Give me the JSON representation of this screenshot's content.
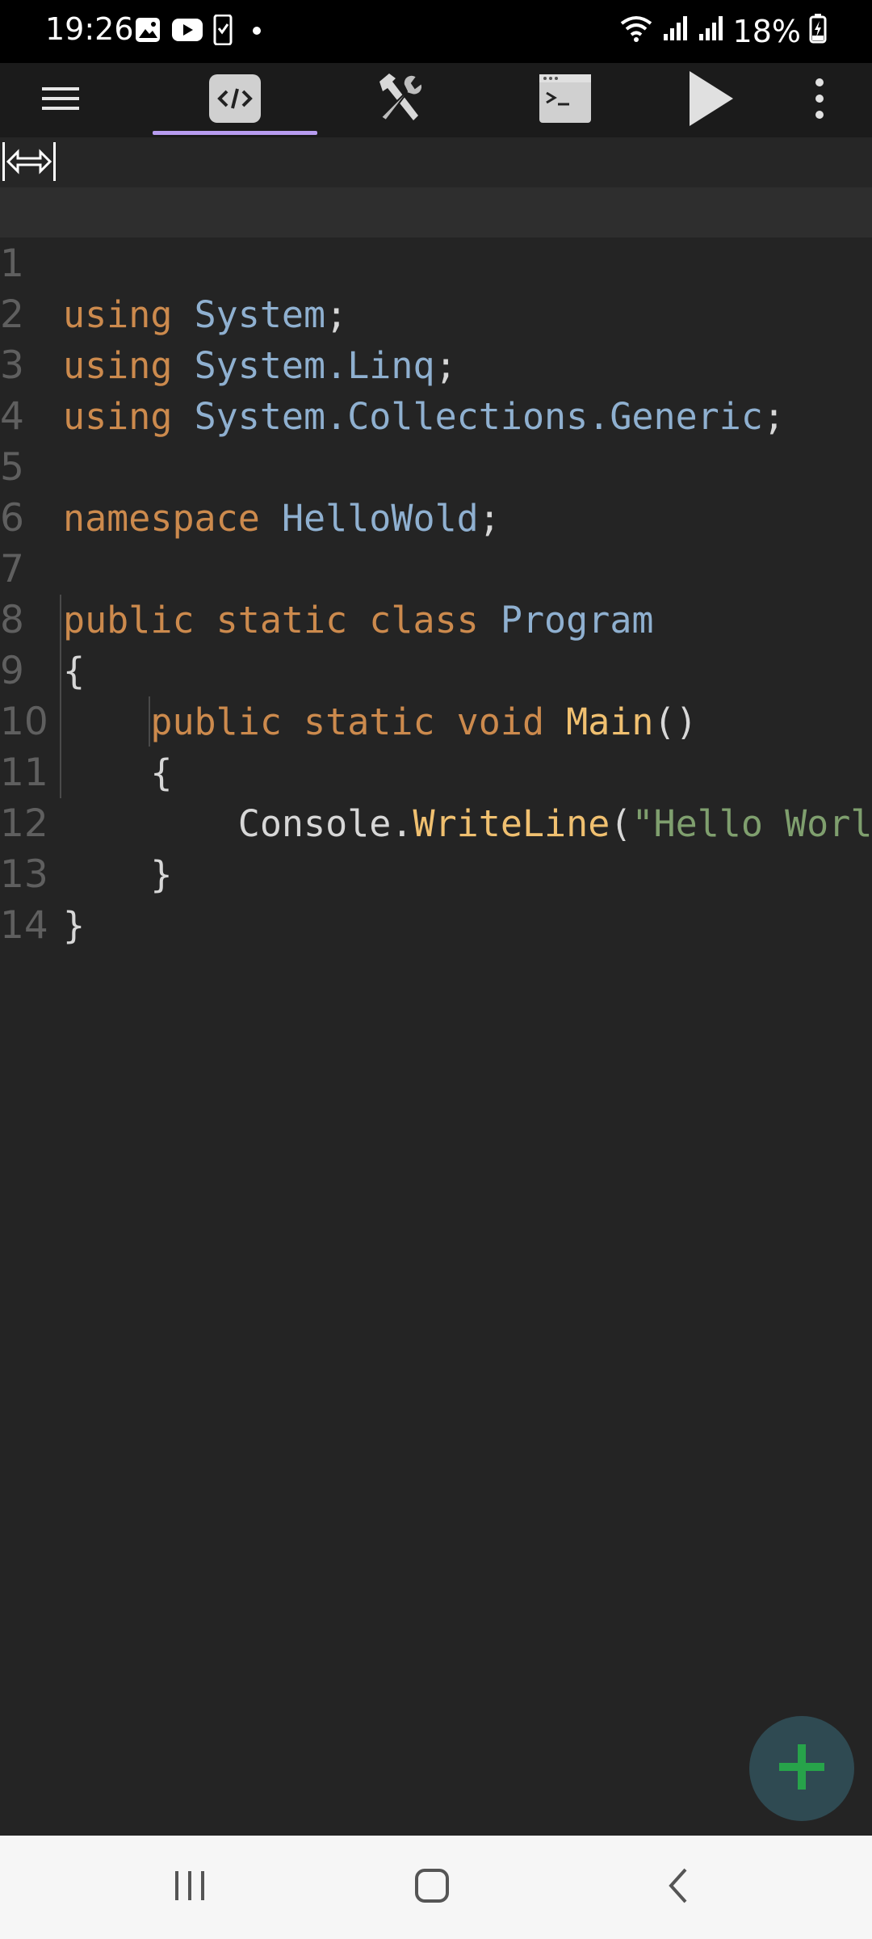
{
  "status_bar": {
    "time": "19:26",
    "battery": "18%",
    "notification_icons": [
      "gallery-icon",
      "youtube-icon",
      "phone-check-icon",
      "dot-icon"
    ],
    "system_icons": [
      "wifi-icon",
      "signal-icon",
      "signal-icon",
      "battery-charging-icon"
    ]
  },
  "toolbar": {
    "items": [
      "menu-icon",
      "code-tab-icon",
      "tools-icon",
      "terminal-icon",
      "run-icon",
      "more-icon"
    ],
    "active_tab": "code",
    "accent": "#b79cf0"
  },
  "editor": {
    "word_wrap_toggle": "word-wrap-toggle-icon",
    "line_numbers": [
      "1",
      "2",
      "3",
      "4",
      "5",
      "6",
      "7",
      "8",
      "9",
      "10",
      "11",
      "12",
      "13",
      "14"
    ],
    "lines": [
      {
        "t1": "using",
        "t2": " ",
        "t3": "System",
        "t4": ";"
      },
      {
        "t1": "using",
        "t2": " ",
        "t3": "System.Linq",
        "t4": ";"
      },
      {
        "t1": "using",
        "t2": " ",
        "t3": "System.Collections.Generic",
        "t4": ";"
      },
      {},
      {
        "t1": "namespace",
        "t2": " ",
        "t3": "HelloWold",
        "t4": ";"
      },
      {},
      {
        "t1": "public static class",
        "t2": " ",
        "t3": "Program",
        "t4": ""
      },
      {
        "t1": "{"
      },
      {
        "indent": "    ",
        "t1": "public static void",
        "t2": " ",
        "t3": "Main",
        "t4": "()"
      },
      {
        "indent": "    ",
        "t1": "{"
      },
      {
        "indent": "        ",
        "t1": "Console.",
        "t2": "WriteLine",
        "t3": "(",
        "t4": "\"Hello World\");"
      },
      {
        "indent": "    ",
        "t1": "}"
      },
      {
        "t1": "}"
      },
      {}
    ]
  },
  "fab": {
    "icon": "plus-icon",
    "color": "#27a34a"
  },
  "nav_bar": {
    "items": [
      "recent-apps-icon",
      "home-icon",
      "back-icon"
    ]
  }
}
